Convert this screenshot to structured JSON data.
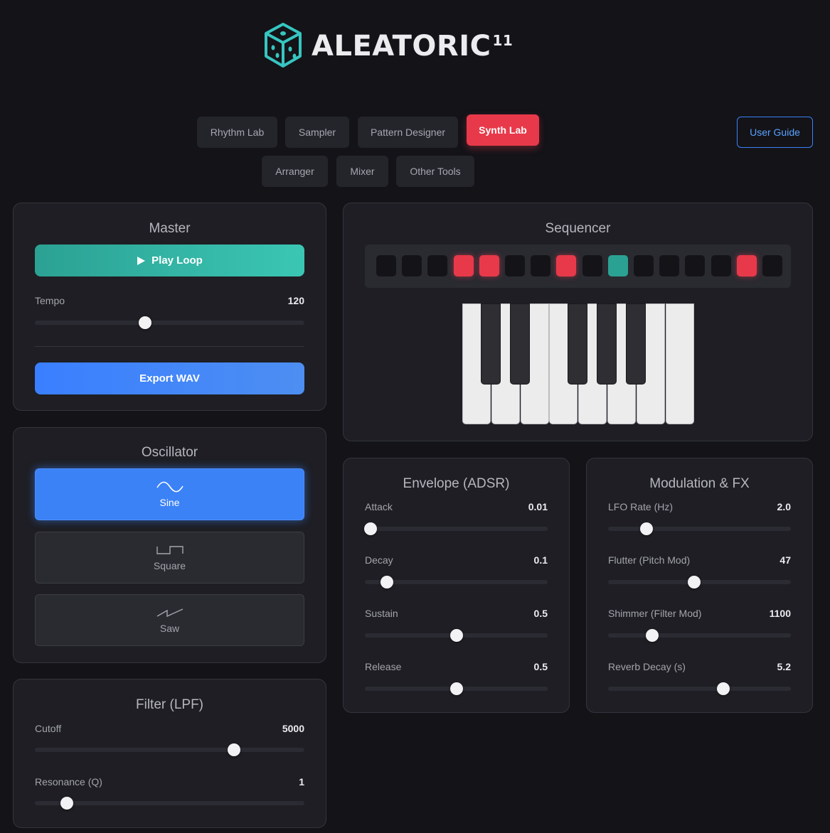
{
  "app": {
    "name": "ALEATORIC",
    "version_sup": "11"
  },
  "nav": {
    "tabs": [
      {
        "label": "Rhythm Lab"
      },
      {
        "label": "Sampler"
      },
      {
        "label": "Pattern Designer"
      },
      {
        "label": "Synth Lab",
        "active": true
      },
      {
        "label": "Arranger"
      },
      {
        "label": "Mixer"
      },
      {
        "label": "Other Tools"
      }
    ],
    "user_guide": "User Guide"
  },
  "master": {
    "title": "Master",
    "play_label": "Play Loop",
    "tempo_label": "Tempo",
    "tempo_value": "120",
    "tempo_fraction": 0.41,
    "export_label": "Export WAV"
  },
  "oscillator": {
    "title": "Oscillator",
    "options": [
      {
        "label": "Sine",
        "icon": "sine-wave-icon",
        "active": true
      },
      {
        "label": "Square",
        "icon": "square-wave-icon"
      },
      {
        "label": "Saw",
        "icon": "saw-wave-icon"
      }
    ]
  },
  "filter": {
    "title": "Filter (LPF)",
    "cutoff_label": "Cutoff",
    "cutoff_value": "5000",
    "cutoff_fraction": 0.74,
    "resonance_label": "Resonance (Q)",
    "resonance_value": "1",
    "resonance_fraction": 0.12
  },
  "sequencer": {
    "title": "Sequencer",
    "steps": [
      "off",
      "off",
      "off",
      "red",
      "red",
      "off",
      "off",
      "red",
      "off",
      "teal",
      "off",
      "off",
      "off",
      "off",
      "red",
      "off"
    ]
  },
  "envelope": {
    "title": "Envelope (ADSR)",
    "params": [
      {
        "label": "Attack",
        "value": "0.01",
        "fraction": 0.03
      },
      {
        "label": "Decay",
        "value": "0.1",
        "fraction": 0.12
      },
      {
        "label": "Sustain",
        "value": "0.5",
        "fraction": 0.5
      },
      {
        "label": "Release",
        "value": "0.5",
        "fraction": 0.5
      }
    ]
  },
  "modulation": {
    "title": "Modulation & FX",
    "params": [
      {
        "label": "LFO Rate (Hz)",
        "value": "2.0",
        "fraction": 0.21
      },
      {
        "label": "Flutter (Pitch Mod)",
        "value": "47",
        "fraction": 0.47
      },
      {
        "label": "Shimmer (Filter Mod)",
        "value": "1100",
        "fraction": 0.24
      },
      {
        "label": "Reverb Decay (s)",
        "value": "5.2",
        "fraction": 0.63
      }
    ]
  },
  "colors": {
    "accent_red": "#e8394a",
    "accent_teal": "#2ba193",
    "accent_blue": "#3b82f6"
  }
}
